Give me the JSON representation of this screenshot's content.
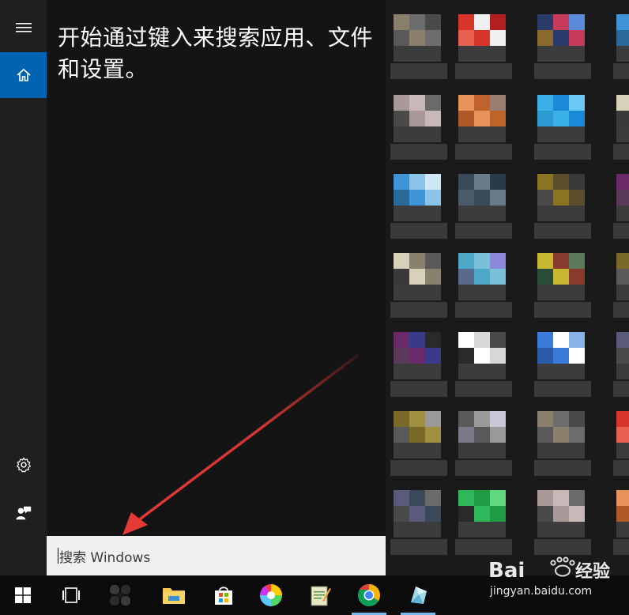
{
  "start_menu": {
    "hint": "开始通过键入来搜索应用、文件和设置。",
    "search_placeholder": "搜索 Windows",
    "rail": {
      "menu_icon": "hamburger-icon",
      "home_icon": "home-icon",
      "settings_icon": "gear-icon",
      "feedback_icon": "feedback-icon"
    }
  },
  "taskbar": {
    "items": [
      {
        "name": "start-button",
        "icon": "windows-logo-icon"
      },
      {
        "name": "task-view-button",
        "icon": "task-view-icon"
      },
      {
        "name": "pinned-app-1",
        "icon": "app-icon"
      },
      {
        "name": "file-explorer-button",
        "icon": "folder-icon"
      },
      {
        "name": "store-button",
        "icon": "store-bag-icon"
      },
      {
        "name": "pinned-app-2",
        "icon": "colorful-ring-icon"
      },
      {
        "name": "pinned-app-3",
        "icon": "notepad-icon"
      },
      {
        "name": "chrome-button",
        "icon": "chrome-icon"
      },
      {
        "name": "pinned-app-4",
        "icon": "crystal-icon"
      }
    ]
  },
  "watermark": {
    "logo_text": "Bai 经验",
    "url": "jingyan.baidu.com"
  },
  "colors": {
    "accent": "#0063b1",
    "panel": "#141414",
    "rail": "#1f1f1f",
    "arrow": "#e53935"
  }
}
